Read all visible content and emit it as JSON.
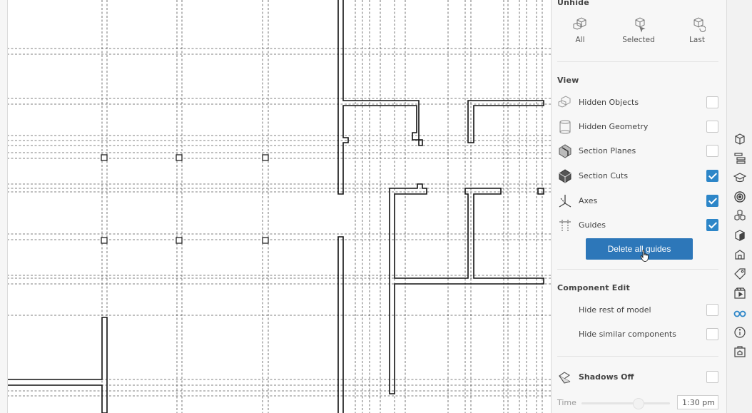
{
  "panel": {
    "unhide": {
      "title": "Unhide",
      "buttons": [
        {
          "label": "All",
          "icon": "unhide-all-icon"
        },
        {
          "label": "Selected",
          "icon": "unhide-selected-icon"
        },
        {
          "label": "Last",
          "icon": "unhide-last-icon"
        }
      ]
    },
    "view": {
      "title": "View",
      "items": [
        {
          "label": "Hidden Objects",
          "icon": "hidden-objects-icon",
          "checked": false
        },
        {
          "label": "Hidden Geometry",
          "icon": "hidden-geometry-icon",
          "checked": false
        },
        {
          "label": "Section Planes",
          "icon": "section-planes-icon",
          "checked": false
        },
        {
          "label": "Section Cuts",
          "icon": "section-cuts-icon",
          "checked": true
        },
        {
          "label": "Axes",
          "icon": "axes-icon",
          "checked": true
        },
        {
          "label": "Guides",
          "icon": "guides-icon",
          "checked": true
        }
      ],
      "delete_guides_label": "Delete all guides"
    },
    "component_edit": {
      "title": "Component Edit",
      "items": [
        {
          "label": "Hide rest of model",
          "checked": false
        },
        {
          "label": "Hide similar components",
          "checked": false
        }
      ]
    },
    "shadows": {
      "label": "Shadows Off",
      "icon": "shadows-icon",
      "checked": false,
      "time_label": "Time",
      "time_value": "1:30 pm"
    }
  },
  "right_rail": {
    "icons": [
      "entity-info-icon",
      "outliner-icon",
      "instructor-icon",
      "materials-icon",
      "components-icon",
      "styles-icon",
      "scenes-icon",
      "tags-icon",
      "animation-icon",
      "display-icon",
      "model-info-icon",
      "extension-icon"
    ],
    "active": "display-icon",
    "accent": "#2d86c8"
  },
  "colors": {
    "accent": "#2d86c8",
    "button": "#2d77b9"
  }
}
